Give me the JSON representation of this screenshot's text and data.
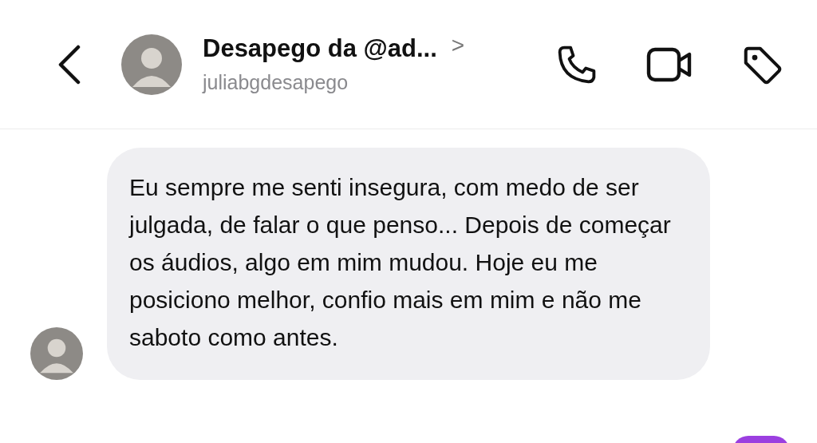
{
  "header": {
    "title": "Desapego da @ad...",
    "subtitle": "juliabgdesapego",
    "chevron": ">"
  },
  "messages": [
    {
      "kind": "incoming",
      "text": "Eu sempre me senti insegura, com medo de ser julgada, de falar o que penso... Depois de começar os áudios, algo em mim mudou. Hoje eu me posiciono melhor, confio mais em mim e não me saboto como antes."
    }
  ]
}
